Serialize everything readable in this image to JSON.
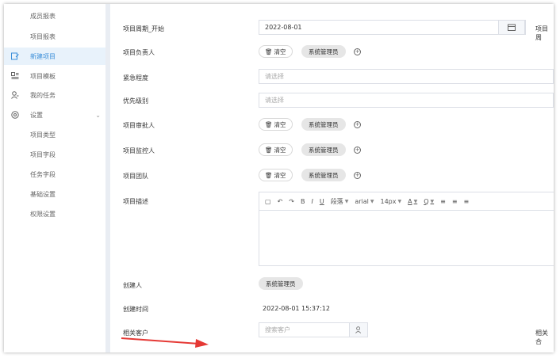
{
  "sidebar": {
    "items": [
      {
        "label": "成员报表",
        "icon": ""
      },
      {
        "label": "项目报表",
        "icon": ""
      },
      {
        "label": "新建项目",
        "icon": "new-project-icon",
        "active": true
      },
      {
        "label": "项目模板",
        "icon": "template-icon"
      },
      {
        "label": "我的任务",
        "icon": "user-task-icon"
      },
      {
        "label": "设置",
        "icon": "settings-icon",
        "expandable": true
      },
      {
        "label": "项目类型",
        "icon": ""
      },
      {
        "label": "项目字段",
        "icon": ""
      },
      {
        "label": "任务字段",
        "icon": ""
      },
      {
        "label": "基础设置",
        "icon": ""
      },
      {
        "label": "权限设置",
        "icon": ""
      }
    ]
  },
  "form": {
    "start_label": "项目周期_开始",
    "start_value": "2022-08-01",
    "end_label_partial": "项目周",
    "owner_label": "项目负责人",
    "urgency_label": "紧急程度",
    "urgency_placeholder": "请选择",
    "priority_label": "优先级别",
    "priority_placeholder": "请选择",
    "approver_label": "项目审批人",
    "monitor_label": "项目监控人",
    "team_label": "项目团队",
    "desc_label": "项目描述",
    "creator_label": "创建人",
    "creator_value": "系统管理员",
    "created_time_label": "创建时间",
    "created_time_value": "2022-08-01 15:37:12",
    "customer_label": "相关客户",
    "customer_placeholder": "搜索客户",
    "related_contract_partial": "相关合",
    "clear_label": "清空",
    "user_chip": "系统管理员"
  },
  "editor": {
    "toolbar": {
      "paragraph": "段落",
      "font": "arial",
      "size": "14px",
      "font_color": "A",
      "bg_color": "Q",
      "bold": "B",
      "italic": "I",
      "underline": "U"
    }
  },
  "colors": {
    "accent": "#3b8fd9",
    "active_bg": "#e8f2fb",
    "arrow": "#e53935"
  }
}
